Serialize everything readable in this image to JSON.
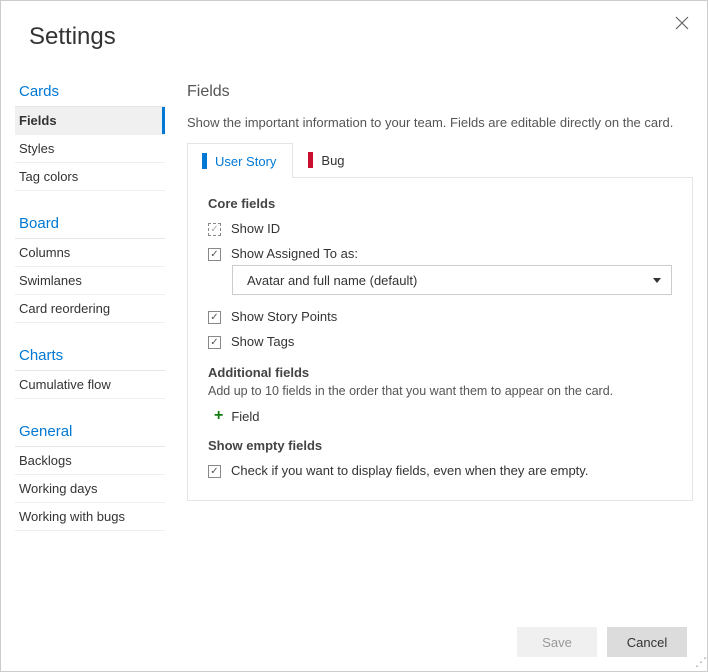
{
  "title": "Settings",
  "sidebar": {
    "groups": [
      {
        "title": "Cards",
        "items": [
          {
            "label": "Fields",
            "active": true
          },
          {
            "label": "Styles"
          },
          {
            "label": "Tag colors"
          }
        ]
      },
      {
        "title": "Board",
        "items": [
          {
            "label": "Columns"
          },
          {
            "label": "Swimlanes"
          },
          {
            "label": "Card reordering"
          }
        ]
      },
      {
        "title": "Charts",
        "items": [
          {
            "label": "Cumulative flow"
          }
        ]
      },
      {
        "title": "General",
        "items": [
          {
            "label": "Backlogs"
          },
          {
            "label": "Working days"
          },
          {
            "label": "Working with bugs"
          }
        ]
      }
    ]
  },
  "main": {
    "heading": "Fields",
    "description": "Show the important information to your team. Fields are editable directly on the card.",
    "tabs": [
      {
        "label": "User Story",
        "color": "#0078d4",
        "active": true
      },
      {
        "label": "Bug",
        "color": "#c8102e",
        "active": false
      }
    ],
    "core": {
      "heading": "Core fields",
      "show_id_label": "Show ID",
      "show_assigned_label": "Show Assigned To as:",
      "assigned_select_value": "Avatar and full name (default)",
      "show_story_points_label": "Show Story Points",
      "show_tags_label": "Show Tags"
    },
    "additional": {
      "heading": "Additional fields",
      "description": "Add up to 10 fields in the order that you want them to appear on the card.",
      "add_label": "Field"
    },
    "empty": {
      "heading": "Show empty fields",
      "label": "Check if you want to display fields, even when they are empty."
    }
  },
  "footer": {
    "save": "Save",
    "cancel": "Cancel"
  }
}
